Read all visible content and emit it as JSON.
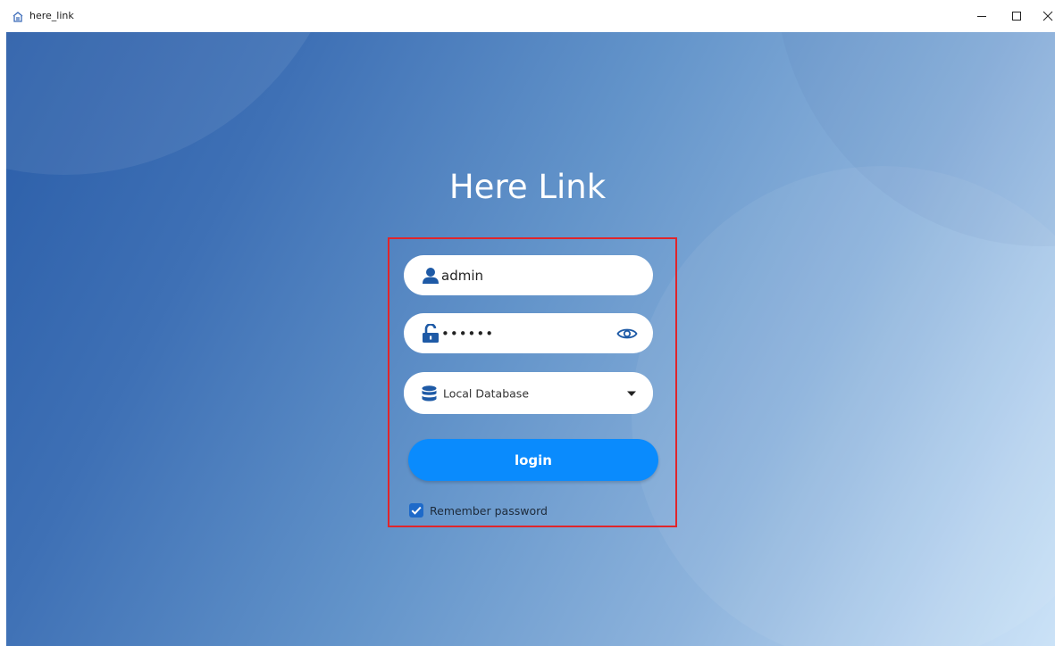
{
  "window": {
    "title": "here_link",
    "icon": "app-icon",
    "controls": [
      "minimize-icon",
      "maximize-icon",
      "close-icon"
    ]
  },
  "login": {
    "heading": "Here Link",
    "username": {
      "value": "admin",
      "icon": "user-icon"
    },
    "password": {
      "masked_value": "••••••",
      "icon": "unlock-icon",
      "toggle_icon": "eye-icon"
    },
    "database": {
      "selected": "Local Database",
      "icon": "database-icon",
      "dropdown_icon": "caret-down-icon"
    },
    "submit_label": "login",
    "remember": {
      "label": "Remember password",
      "checked": true
    }
  },
  "colors": {
    "primary_button": "#0a8bfd",
    "icon_blue": "#1e5aa6",
    "highlight_border": "#e0252b",
    "checkbox": "#1e6ac9"
  }
}
